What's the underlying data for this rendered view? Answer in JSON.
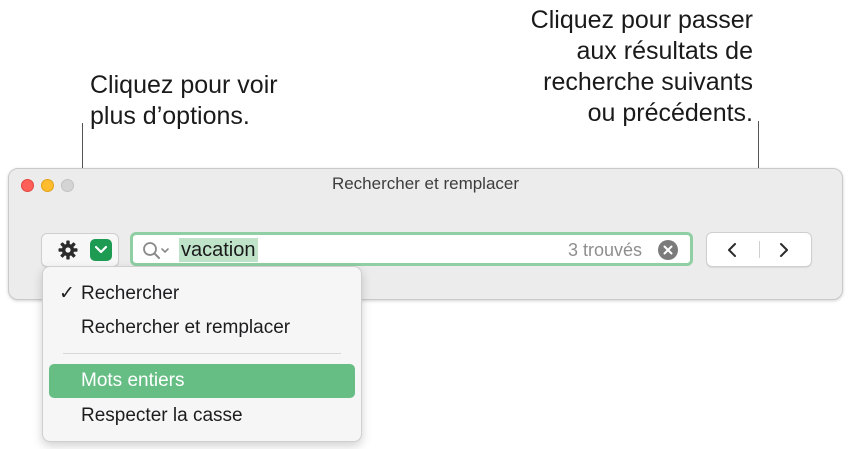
{
  "callouts": {
    "options_line1": "Cliquez pour voir",
    "options_line2": "plus d’options.",
    "nav_line1": "Cliquez pour passer",
    "nav_line2": "aux résultats de",
    "nav_line3": "recherche suivants",
    "nav_line4": "ou précédents."
  },
  "window": {
    "title": "Rechercher et remplacer"
  },
  "options_button": {
    "icon": "gear-icon",
    "chevron_icon": "chevron-down-icon",
    "accent_color": "#1e9b53"
  },
  "search": {
    "value": "vacation",
    "match_count": "3 trouvés",
    "icon": "search-icon",
    "clear_icon": "clear-icon"
  },
  "navigation": {
    "prev_icon": "chevron-left-icon",
    "next_icon": "chevron-right-icon"
  },
  "menu": {
    "items": [
      {
        "label": "Rechercher",
        "checked": true
      },
      {
        "label": "Rechercher et remplacer",
        "checked": false
      },
      {
        "label": "Mots entiers",
        "highlighted": true
      },
      {
        "label": "Respecter la casse",
        "highlighted": false
      }
    ],
    "check_mark": "✓",
    "highlight_color": "#67be85"
  }
}
